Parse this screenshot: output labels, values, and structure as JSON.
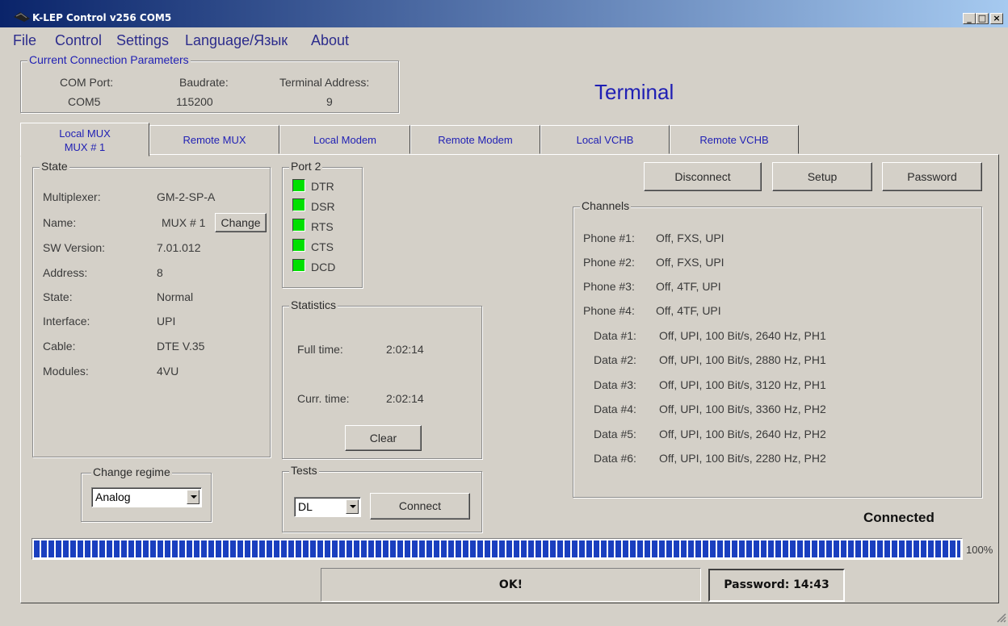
{
  "window": {
    "title": "K-LEP Control v256 COM5",
    "minimize": "_",
    "maximize": "□",
    "close": "×"
  },
  "menu": [
    "File",
    "Control",
    "Settings",
    "Language/Язык",
    "About"
  ],
  "connection": {
    "legend": "Current Connection Parameters",
    "com_port_label": "COM Port:",
    "com_port_value": "COM5",
    "baudrate_label": "Baudrate:",
    "baudrate_value": "115200",
    "terminal_address_label": "Terminal Address:",
    "terminal_address_value": "9"
  },
  "heading": "Terminal",
  "tabs": [
    {
      "line1": "Local MUX",
      "line2": "MUX # 1"
    },
    {
      "label": "Remote MUX"
    },
    {
      "label": "Local Modem"
    },
    {
      "label": "Remote Modem"
    },
    {
      "label": "Local VCHB"
    },
    {
      "label": "Remote VCHB"
    }
  ],
  "state": {
    "legend": "State",
    "rows": [
      {
        "label": "Multiplexer:",
        "value": "GM-2-SP-A"
      },
      {
        "label": "Name:",
        "value": "MUX # 1"
      },
      {
        "label": "SW Version:",
        "value": "7.01.012"
      },
      {
        "label": "Address:",
        "value": "8"
      },
      {
        "label": "State:",
        "value": "Normal"
      },
      {
        "label": "Interface:",
        "value": "UPI"
      },
      {
        "label": "Cable:",
        "value": "DTE V.35"
      },
      {
        "label": "Modules:",
        "value": "4VU"
      }
    ],
    "change_button": "Change"
  },
  "change_regime": {
    "legend": "Change regime",
    "selected": "Analog"
  },
  "port": {
    "legend": "Port 2",
    "signals": [
      "DTR",
      "DSR",
      "RTS",
      "CTS",
      "DCD"
    ],
    "led_color": "#00e000"
  },
  "statistics": {
    "legend": "Statistics",
    "full_time_label": "Full time:",
    "full_time_value": "2:02:14",
    "curr_time_label": "Curr. time:",
    "curr_time_value": "2:02:14",
    "clear_button": "Clear"
  },
  "tests": {
    "legend": "Tests",
    "selected": "DL",
    "connect_button": "Connect"
  },
  "actions": {
    "disconnect": "Disconnect",
    "setup": "Setup",
    "password": "Password"
  },
  "channels": {
    "legend": "Channels",
    "rows": [
      {
        "label": "Phone #1:",
        "value": "Off, FXS, UPI"
      },
      {
        "label": "Phone #2:",
        "value": "Off, FXS, UPI"
      },
      {
        "label": "Phone #3:",
        "value": "Off, 4TF, UPI"
      },
      {
        "label": "Phone #4:",
        "value": "Off, 4TF, UPI"
      },
      {
        "label": "Data #1:",
        "value": "Off, UPI, 100 Bit/s, 2640 Hz, PH1"
      },
      {
        "label": "Data #2:",
        "value": "Off, UPI, 100 Bit/s, 2880 Hz, PH1"
      },
      {
        "label": "Data #3:",
        "value": "Off, UPI, 100 Bit/s, 3120 Hz, PH1"
      },
      {
        "label": "Data #4:",
        "value": "Off, UPI, 100 Bit/s, 3360 Hz, PH2"
      },
      {
        "label": "Data #5:",
        "value": "Off, UPI, 100 Bit/s, 2640 Hz, PH2"
      },
      {
        "label": "Data #6:",
        "value": "Off, UPI, 100 Bit/s, 2280 Hz, PH2"
      }
    ]
  },
  "status": {
    "connection_state": "Connected",
    "progress_percent": 100,
    "progress_label": "100%",
    "progress_color": "#1a3fbf",
    "message": "OK!",
    "password_timer": "Password: 14:43"
  }
}
